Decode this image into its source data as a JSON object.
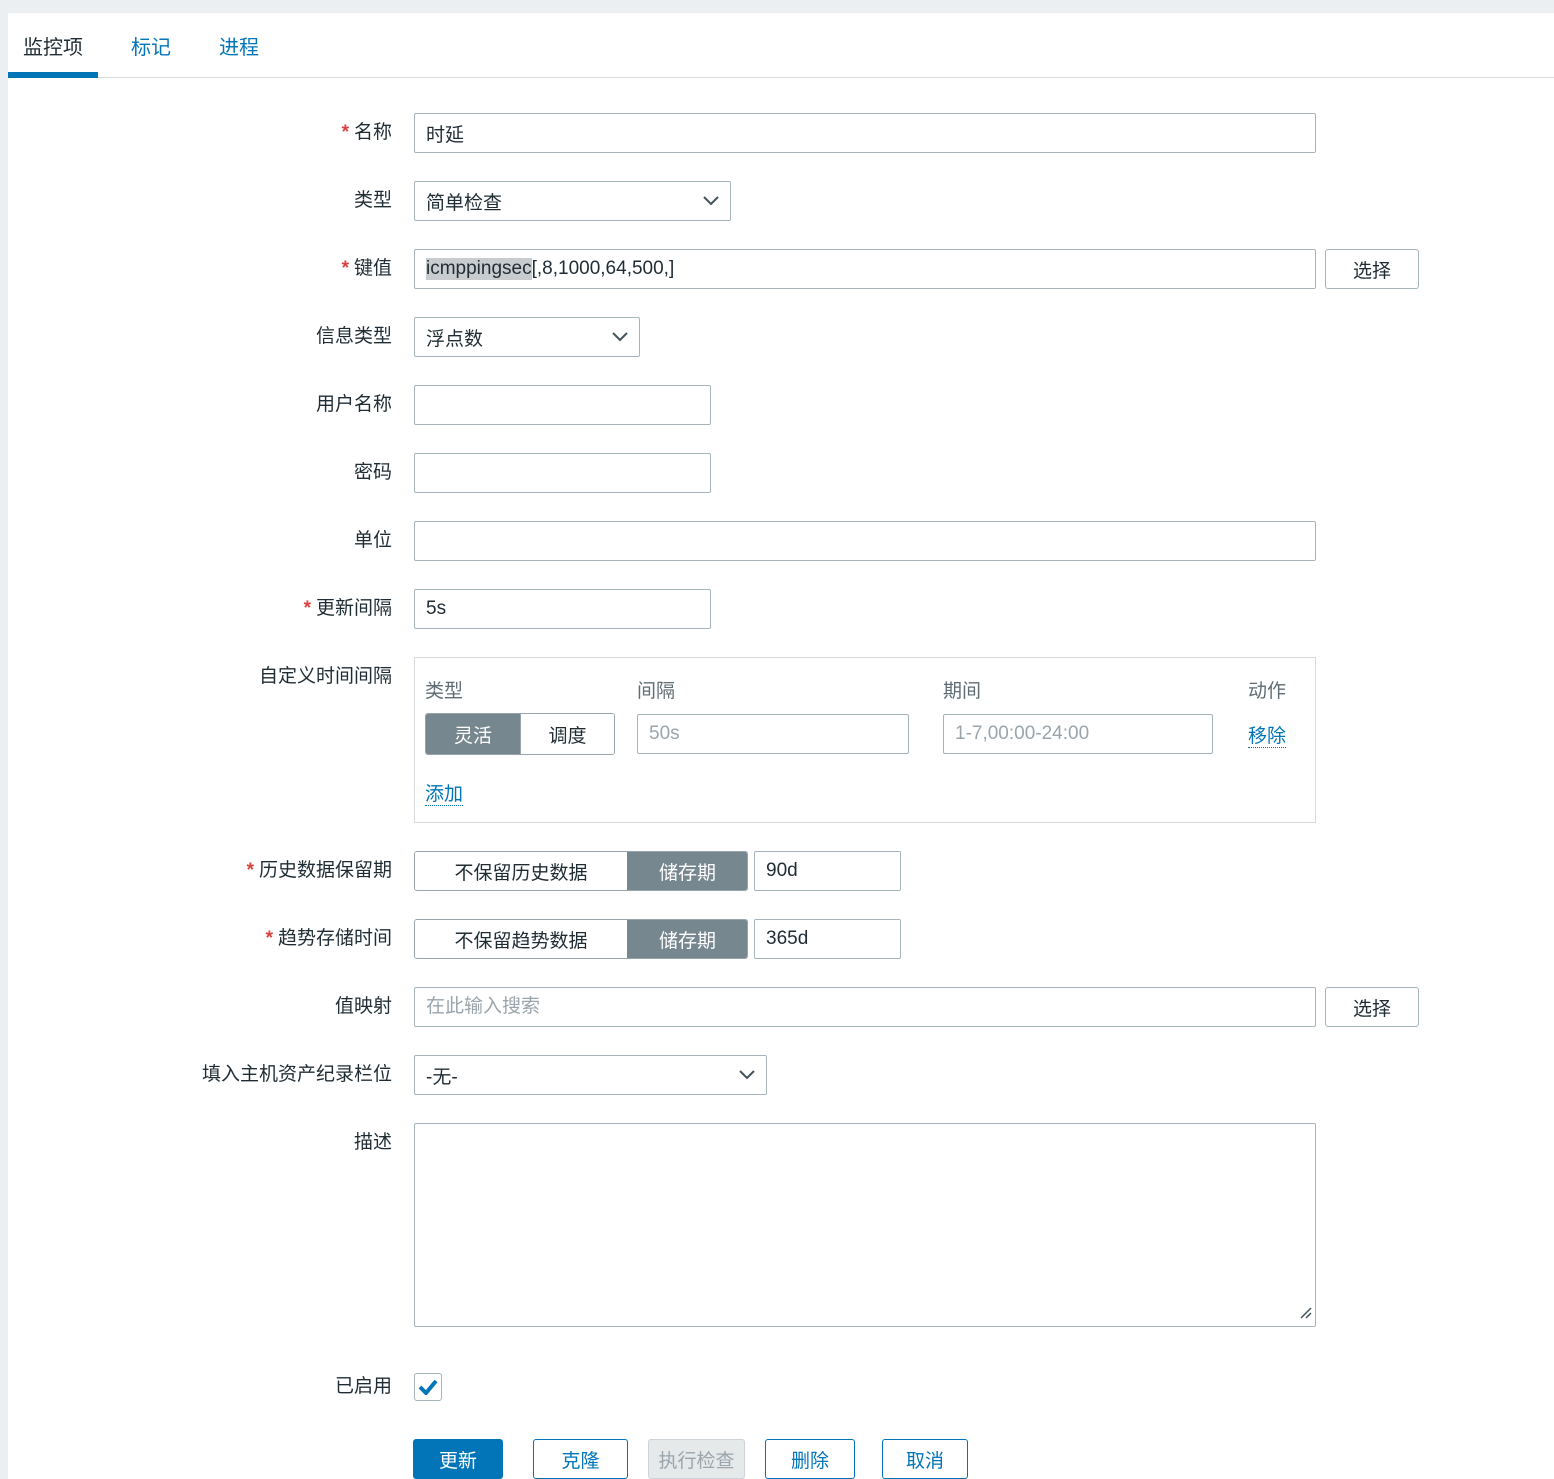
{
  "tabs": [
    {
      "label": "监控项",
      "active": true
    },
    {
      "label": "标记",
      "active": false
    },
    {
      "label": "进程",
      "active": false
    }
  ],
  "form": {
    "name": {
      "label": "名称",
      "required": true,
      "value": "时延"
    },
    "type": {
      "label": "类型",
      "value": "简单检查"
    },
    "key": {
      "label": "键值",
      "required": true,
      "value_selected": "icmppingsec",
      "value_rest": "[,8,1000,64,500,]",
      "select_button": "选择"
    },
    "info_type": {
      "label": "信息类型",
      "value": "浮点数"
    },
    "username": {
      "label": "用户名称",
      "value": ""
    },
    "password": {
      "label": "密码",
      "value": ""
    },
    "units": {
      "label": "单位",
      "value": ""
    },
    "update_interval": {
      "label": "更新间隔",
      "required": true,
      "value": "5s"
    },
    "custom_intervals": {
      "label": "自定义时间间隔",
      "columns": [
        "类型",
        "间隔",
        "期间",
        "动作"
      ],
      "row": {
        "type_options": [
          "灵活",
          "调度"
        ],
        "type_selected": "灵活",
        "interval_placeholder": "50s",
        "period_placeholder": "1-7,00:00-24:00",
        "remove_label": "移除"
      },
      "add_label": "添加"
    },
    "history": {
      "label": "历史数据保留期",
      "required": true,
      "off_option": "不保留历史数据",
      "on_option": "储存期",
      "selected": "储存期",
      "value": "90d"
    },
    "trends": {
      "label": "趋势存储时间",
      "required": true,
      "off_option": "不保留趋势数据",
      "on_option": "储存期",
      "selected": "储存期",
      "value": "365d"
    },
    "valuemap": {
      "label": "值映射",
      "placeholder": "在此输入搜索",
      "value": "",
      "select_button": "选择"
    },
    "inventory": {
      "label": "填入主机资产纪录栏位",
      "value": "-无-"
    },
    "description": {
      "label": "描述",
      "value": ""
    },
    "enabled": {
      "label": "已启用",
      "checked": true
    }
  },
  "footer_buttons": [
    {
      "label": "更新",
      "style": "primary"
    },
    {
      "label": "克隆",
      "style": "secondary"
    },
    {
      "label": "执行检查",
      "style": "disabled"
    },
    {
      "label": "删除",
      "style": "secondary"
    },
    {
      "label": "取消",
      "style": "secondary"
    }
  ],
  "colors": {
    "accent": "#0275b8",
    "toggle_selected": "#77878f",
    "required_asterisk": "#d9413f",
    "selection_highlight": "#c8cccf"
  }
}
